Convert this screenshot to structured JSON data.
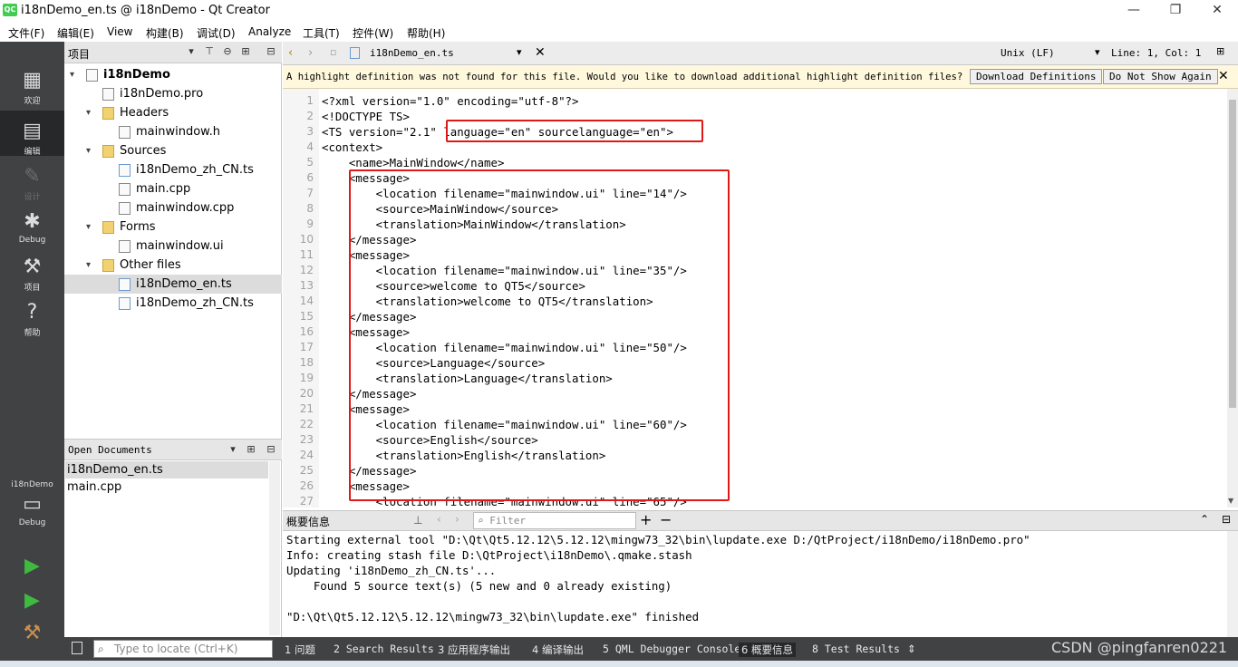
{
  "window": {
    "title": "i18nDemo_en.ts @ i18nDemo - Qt Creator",
    "app_icon_text": "QC",
    "min": "—",
    "restore": "❐",
    "close": "✕"
  },
  "menu": [
    "文件(F)",
    "编辑(E)",
    "View",
    "构建(B)",
    "调试(D)",
    "Analyze",
    "工具(T)",
    "控件(W)",
    "帮助(H)"
  ],
  "modes": [
    {
      "label": "欢迎",
      "icon": "grid-icon"
    },
    {
      "label": "编辑",
      "icon": "edit-icon"
    },
    {
      "label": "设计",
      "icon": "pencil-icon"
    },
    {
      "label": "Debug",
      "icon": "bug-icon"
    },
    {
      "label": "项目",
      "icon": "wrench-icon"
    },
    {
      "label": "帮助",
      "icon": "help-icon"
    }
  ],
  "kit": {
    "label": "i18nDemo",
    "mode": "Debug"
  },
  "project_pane": {
    "title": "项目",
    "tree": [
      {
        "text": "i18nDemo",
        "level": 0,
        "kind": "project",
        "expanded": true,
        "bold": true
      },
      {
        "text": "i18nDemo.pro",
        "level": 1,
        "kind": "pro"
      },
      {
        "text": "Headers",
        "level": 1,
        "kind": "folder",
        "expanded": true,
        "badge": "h"
      },
      {
        "text": "mainwindow.h",
        "level": 2,
        "kind": "h"
      },
      {
        "text": "Sources",
        "level": 1,
        "kind": "folder",
        "expanded": true,
        "badge": "c+"
      },
      {
        "text": "i18nDemo_zh_CN.ts",
        "level": 2,
        "kind": "ts"
      },
      {
        "text": "main.cpp",
        "level": 2,
        "kind": "cpp"
      },
      {
        "text": "mainwindow.cpp",
        "level": 2,
        "kind": "cpp"
      },
      {
        "text": "Forms",
        "level": 1,
        "kind": "folder",
        "expanded": true,
        "badge": ""
      },
      {
        "text": "mainwindow.ui",
        "level": 2,
        "kind": "ui"
      },
      {
        "text": "Other files",
        "level": 1,
        "kind": "folder",
        "expanded": true,
        "badge": ""
      },
      {
        "text": "i18nDemo_en.ts",
        "level": 2,
        "kind": "ts",
        "selected": true
      },
      {
        "text": "i18nDemo_zh_CN.ts",
        "level": 2,
        "kind": "ts"
      }
    ]
  },
  "open_docs": {
    "title": "Open Documents",
    "items": [
      {
        "text": "i18nDemo_en.ts",
        "selected": true
      },
      {
        "text": "main.cpp",
        "selected": false
      }
    ]
  },
  "editor_header": {
    "file": "i18nDemo_en.ts",
    "line_ending": "Unix (LF)",
    "position": "Line: 1, Col: 1"
  },
  "infobar": {
    "message": "A highlight definition was not found for this file. Would you like to download additional highlight definition files?",
    "download": "Download Definitions",
    "dont_show": "Do Not Show Again"
  },
  "code": [
    "<?xml version=\"1.0\" encoding=\"utf-8\"?>",
    "<!DOCTYPE TS>",
    "<TS version=\"2.1\" language=\"en\" sourcelanguage=\"en\">",
    "<context>",
    "    <name>MainWindow</name>",
    "    <message>",
    "        <location filename=\"mainwindow.ui\" line=\"14\"/>",
    "        <source>MainWindow</source>",
    "        <translation>MainWindow</translation>",
    "    </message>",
    "    <message>",
    "        <location filename=\"mainwindow.ui\" line=\"35\"/>",
    "        <source>welcome to QT5</source>",
    "        <translation>welcome to QT5</translation>",
    "    </message>",
    "    <message>",
    "        <location filename=\"mainwindow.ui\" line=\"50\"/>",
    "        <source>Language</source>",
    "        <translation>Language</translation>",
    "    </message>",
    "    <message>",
    "        <location filename=\"mainwindow.ui\" line=\"60\"/>",
    "        <source>English</source>",
    "        <translation>English</translation>",
    "    </message>",
    "    <message>",
    "        <location filename=\"mainwindow.ui\" line=\"65\"/>"
  ],
  "output_pane": {
    "title": "概要信息",
    "filter_placeholder": "Filter",
    "lines": [
      "Starting external tool \"D:\\Qt\\Qt5.12.12\\5.12.12\\mingw73_32\\bin\\lupdate.exe D:/QtProject/i18nDemo/i18nDemo.pro\"",
      "Info: creating stash file D:\\QtProject\\i18nDemo\\.qmake.stash",
      "Updating 'i18nDemo_zh_CN.ts'...",
      "    Found 5 source text(s) (5 new and 0 already existing)",
      "",
      "\"D:\\Qt\\Qt5.12.12\\5.12.12\\mingw73_32\\bin\\lupdate.exe\" finished"
    ]
  },
  "statusbar": {
    "locate_placeholder": "Type to locate (Ctrl+K)",
    "tabs": [
      "1 问题",
      "2 Search Results",
      "3 应用程序输出",
      "4 编译输出",
      "5 QML Debugger Console",
      "6 概要信息",
      "8 Test Results"
    ],
    "watermark": "CSDN @pingfanren0221"
  },
  "colors": {
    "accent_red": "#e01818",
    "sidebar": "#404244",
    "infobar": "#fff8dc"
  }
}
